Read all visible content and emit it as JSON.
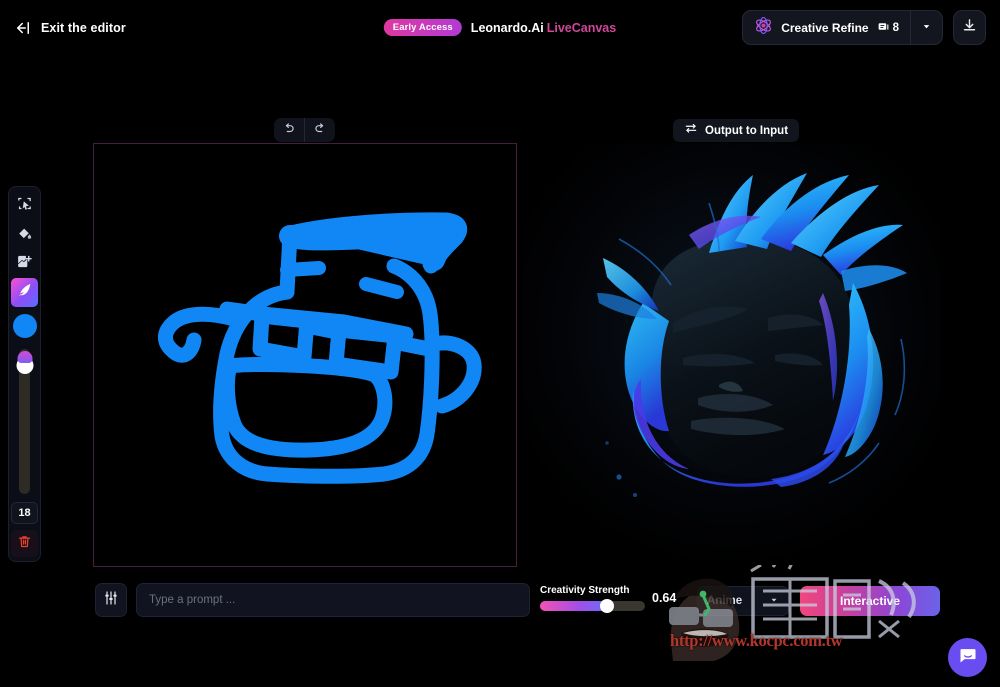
{
  "header": {
    "exit_label": "Exit the editor",
    "exit_icon": "arrow-left-to-bar-icon",
    "early_access_badge": "Early Access",
    "brand_main": "Leonardo.Ai",
    "brand_sub": "LiveCanvas",
    "refine_label": "Creative Refine",
    "refine_icon": "atom-icon",
    "token_count": "8",
    "token_icon": "token-coin-icon",
    "caret_icon": "chevron-down-icon",
    "download_icon": "download-icon"
  },
  "toolbar": {
    "tools": [
      {
        "name": "select-tool",
        "icon": "marquee-select-icon",
        "active": false
      },
      {
        "name": "fill-tool",
        "icon": "paint-bucket-icon",
        "active": false
      },
      {
        "name": "add-image-tool",
        "icon": "image-plus-icon",
        "active": false
      },
      {
        "name": "brush-tool",
        "icon": "brush-stroke-icon",
        "active": true
      }
    ],
    "color_swatch": "#1187f5",
    "brush_size": "18",
    "delete_icon": "trash-icon"
  },
  "canvas": {
    "undo_icon": "undo-arrow-icon",
    "redo_icon": "redo-arrow-icon",
    "output_to_input_label": "Output to Input",
    "output_to_input_icon": "swap-arrows-icon",
    "input_alt": "blue-doodle-face-with-glasses-and-hat",
    "output_alt": "anime-character-with-blue-hair-dark-background"
  },
  "bottom_bar": {
    "settings_icon": "sliders-icon",
    "prompt_value": "",
    "prompt_placeholder": "Type a prompt ...",
    "creativity_label": "Creativity Strength",
    "creativity_value": "0.64",
    "style_label": "Anime",
    "style_caret_icon": "chevron-down-icon",
    "generate_label": "Interactive"
  },
  "watermark": {
    "site_url": "http://www.kocpc.com.tw",
    "brand_text": "電腦王阿達",
    "mascot_icon": "cartoon-face-watermark-icon"
  },
  "chat": {
    "icon": "chat-bubble-icon"
  },
  "colors": {
    "accent_pink": "#e0389f",
    "accent_purple": "#8b4ff5",
    "brush_blue": "#1187f5",
    "panel_bg": "#0c0e17",
    "page_bg": "#000000"
  }
}
